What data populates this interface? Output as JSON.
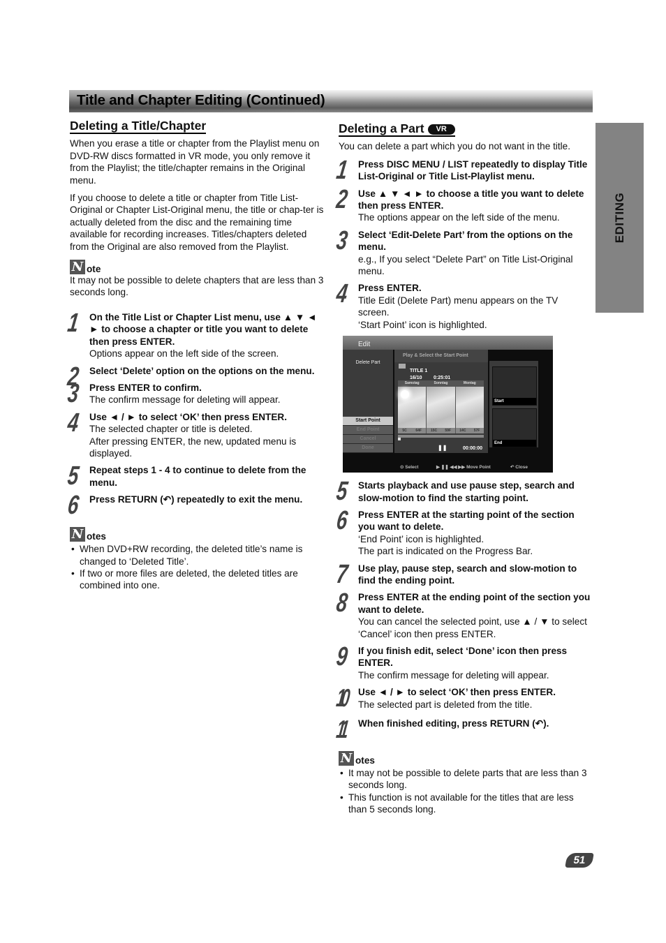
{
  "header": {
    "title": "Title and Chapter Editing (Continued)"
  },
  "side_tab": {
    "label": "EDITING"
  },
  "left": {
    "heading": "Deleting a Title/Chapter",
    "paragraphs": [
      "When you erase a title or chapter from the Playlist menu on DVD-RW discs formatted in VR mode, you only remove it from the Playlist; the title/chapter remains in the Original menu.",
      "If you choose to delete a title or chapter from Title List-Original or Chapter List-Original menu, the title or chap-ter is actually deleted from the disc and the remaining time available for recording increases. Titles/chapters deleted from the Original are also removed from the Playlist."
    ],
    "note": {
      "icon_letter": "N",
      "label": "ote",
      "text": "It may not be possible to delete chapters that are less than 3 seconds long."
    },
    "steps": [
      {
        "num": "1",
        "bold": "On the Title List or Chapter List menu, use ▲ ▼ ◄ ► to choose a chapter or title you want to delete then press ENTER.",
        "sub": "Options appear on the left side of the screen."
      },
      {
        "num": "2",
        "bold": "Select ‘Delete’ option on the options on the menu.",
        "sub": ""
      },
      {
        "num": "3",
        "bold": "Press ENTER to confirm.",
        "sub": "The confirm message for deleting will appear."
      },
      {
        "num": "4",
        "bold": "Use ◄ / ► to select ‘OK’ then press ENTER.",
        "sub": "The selected chapter or title is deleted.",
        "sub2": "After pressing ENTER, the new, updated menu is displayed."
      },
      {
        "num": "5",
        "bold": "Repeat steps 1 - 4 to continue to delete from the menu.",
        "sub": ""
      },
      {
        "num": "6",
        "bold": "Press RETURN (↶) repeatedly to exit the menu.",
        "sub": ""
      }
    ],
    "notes": {
      "icon_letter": "N",
      "label": "otes",
      "items": [
        "When DVD+RW recording, the deleted title’s name is changed to ‘Deleted Title’.",
        "If two or more files are deleted, the deleted titles are combined into one."
      ]
    }
  },
  "right": {
    "heading": "Deleting a Part",
    "badge": "VR",
    "intro": "You can delete a part which you do not want in the title.",
    "steps": [
      {
        "num": "1",
        "bold": "Press DISC MENU / LIST repeatedly to display Title List-Original or Title List-Playlist menu.",
        "sub": ""
      },
      {
        "num": "2",
        "bold": "Use ▲ ▼ ◄ ► to choose a title you want to delete then press ENTER.",
        "sub": "The options appear on the left side of the menu."
      },
      {
        "num": "3",
        "bold": "Select ‘Edit-Delete Part’ from the options on the menu.",
        "sub": "e.g., If you select “Delete Part” on Title List-Original menu."
      },
      {
        "num": "4",
        "bold": "Press ENTER.",
        "sub": "Title Edit (Delete Part) menu appears on the TV screen.",
        "sub2": "‘Start Point’ icon is highlighted."
      },
      {
        "num": "5",
        "bold": "Starts playback and use pause step, search and slow-motion to find the starting point.",
        "sub": ""
      },
      {
        "num": "6",
        "bold": "Press ENTER at the starting point of the section you want to delete.",
        "sub": "‘End Point’ icon is highlighted.",
        "sub2": "The part is indicated on the Progress Bar."
      },
      {
        "num": "7",
        "bold": "Use play, pause step, search and slow-motion to find the ending point.",
        "sub": ""
      },
      {
        "num": "8",
        "bold": "Press ENTER at the ending point of the section you want to delete.",
        "sub": "You can cancel the selected point, use ▲ / ▼ to select ‘Cancel’ icon then press ENTER."
      },
      {
        "num": "9",
        "bold": "If you finish edit, select ‘Done’ icon then press ENTER.",
        "sub": "The confirm message for deleting will appear."
      },
      {
        "num": "10",
        "bold": "Use ◄ / ► to select ‘OK’ then press ENTER.",
        "sub": "The selected part is deleted from the title."
      },
      {
        "num": "11",
        "bold": "When finished editing, press RETURN (↶).",
        "sub": ""
      }
    ],
    "notes": {
      "icon_letter": "N",
      "label": "otes",
      "items": [
        "It may not be possible to delete parts that are less than 3 seconds long.",
        "This function is not available for the titles that are less than 5 seconds long."
      ]
    }
  },
  "tv_screen": {
    "top_title": "Edit",
    "left_title": "Delete Part",
    "options": [
      "Start Point",
      "End Point",
      "Cancel",
      "Done"
    ],
    "active_option": "Start Point",
    "mid_header": "Play & Select the Start Point",
    "title_name": "TITLE 1",
    "date": "16/10",
    "duration": "0:25:01",
    "thumbnail_days": [
      {
        "day": "Samstag",
        "temps": [
          "5C",
          "64F"
        ]
      },
      {
        "day": "Sonntag",
        "temps": [
          "15C",
          "59F"
        ]
      },
      {
        "day": "Montag",
        "temps": [
          "14C",
          "57F"
        ]
      }
    ],
    "progress": 0.0,
    "pause_symbol": "❚❚",
    "time": "00:00:00",
    "start_label": "Start",
    "end_label": "End",
    "bottom": {
      "select": "⊙ Select",
      "move": "▶ ❚❚ ◀◀ ▶▶ Move Point",
      "close": "↶ Close"
    }
  },
  "page_number": "51"
}
